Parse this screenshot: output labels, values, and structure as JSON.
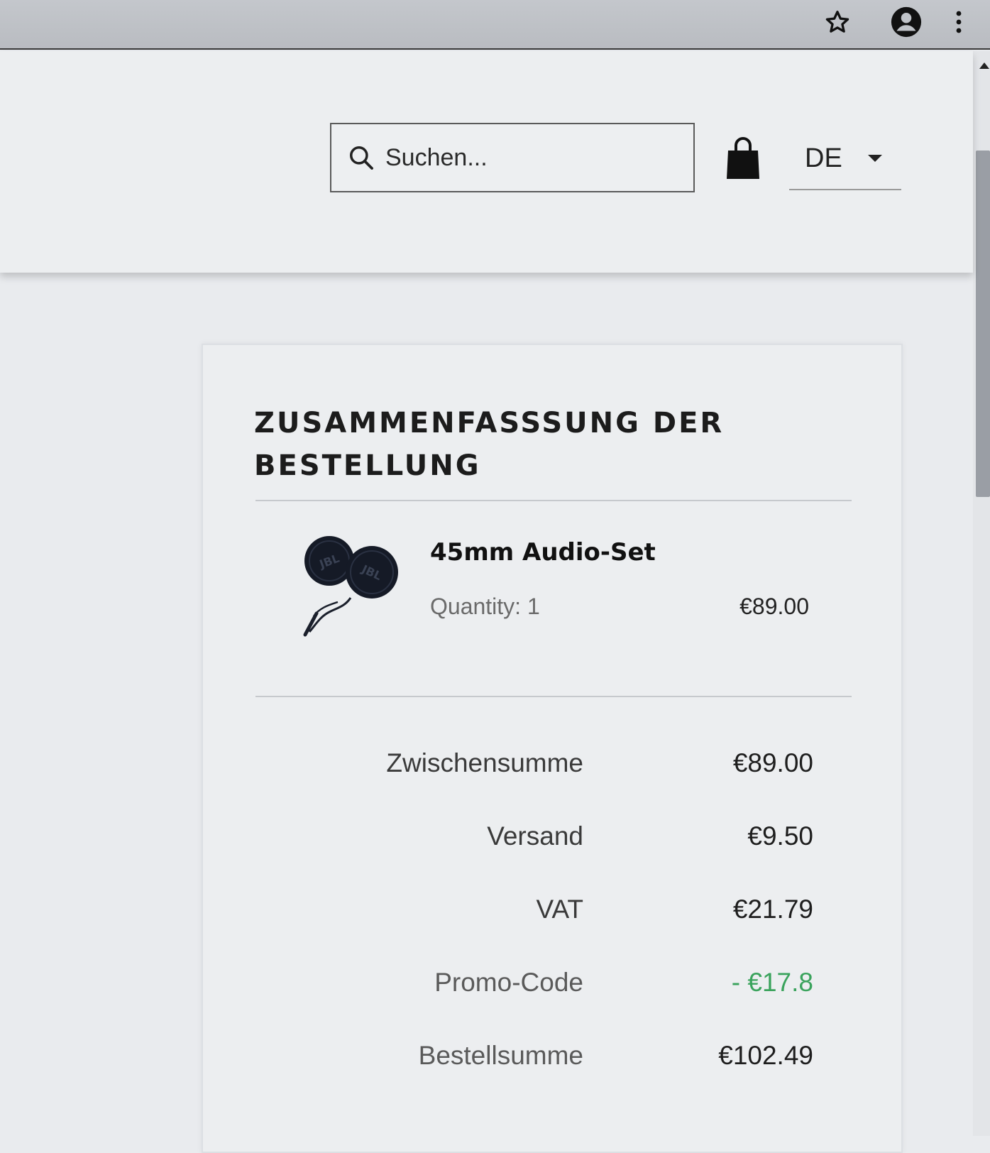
{
  "browser": {
    "icons": [
      "star-icon",
      "account-icon",
      "menu-icon"
    ]
  },
  "header": {
    "search": {
      "placeholder": "Suchen...",
      "value": ""
    },
    "language": {
      "selected": "DE"
    }
  },
  "summary": {
    "title": "ZUSAMMENFASSSUNG DER BESTELLUNG",
    "item": {
      "name": "45mm Audio-Set",
      "quantity": "Quantity: 1",
      "price": "€89.00"
    },
    "totals": [
      {
        "label": "Zwischensumme",
        "value": "€89.00"
      },
      {
        "label": "Versand",
        "value": "€9.50"
      },
      {
        "label": "VAT",
        "value": "€21.79"
      },
      {
        "label": "Promo-Code",
        "value": "- €17.8"
      },
      {
        "label": "Bestellsumme",
        "value": "€102.49"
      }
    ]
  },
  "colors": {
    "discount": "#3aa35c",
    "text": "#1a1a1a",
    "background": "#eceef0"
  }
}
